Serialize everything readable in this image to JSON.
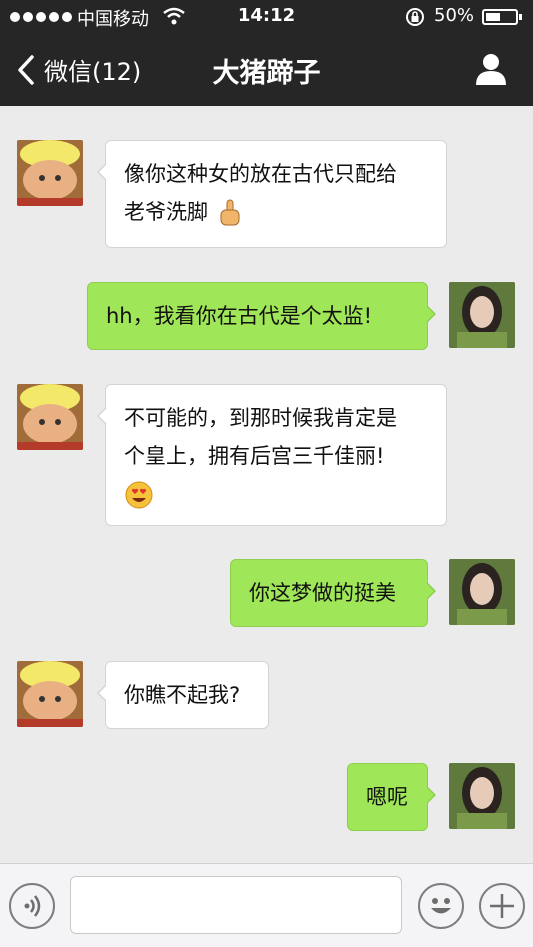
{
  "status_bar": {
    "carrier": "中国移动",
    "time": "14:12",
    "battery_percent": "50%"
  },
  "nav": {
    "back_label": "微信(12)",
    "title": "大猪蹄子"
  },
  "messages": [
    {
      "side": "left",
      "lines": [
        "像你这种女的放在古代只配给",
        "老爷洗脚"
      ],
      "emoji": "pointing-finger-emoji"
    },
    {
      "side": "right",
      "lines": [
        "hh，我看你在古代是个太监!"
      ]
    },
    {
      "side": "left",
      "lines": [
        "不可能的，到那时候我肯定是",
        "个皇上，拥有后宫三千佳丽!"
      ],
      "emoji": "heart-eyes-emoji"
    },
    {
      "side": "right",
      "lines": [
        "你这梦做的挺美"
      ]
    },
    {
      "side": "left",
      "lines": [
        "你瞧不起我?"
      ]
    },
    {
      "side": "right",
      "lines": [
        "嗯呢"
      ]
    }
  ],
  "input": {
    "value": "",
    "placeholder": ""
  },
  "icons": {
    "voice": "voice-icon",
    "emoji": "emoji-icon",
    "add": "add-icon"
  },
  "colors": {
    "nav_bg": "#262626",
    "chat_bg": "#ebebeb",
    "bubble_sent": "#9fe658",
    "bubble_received": "#ffffff"
  }
}
